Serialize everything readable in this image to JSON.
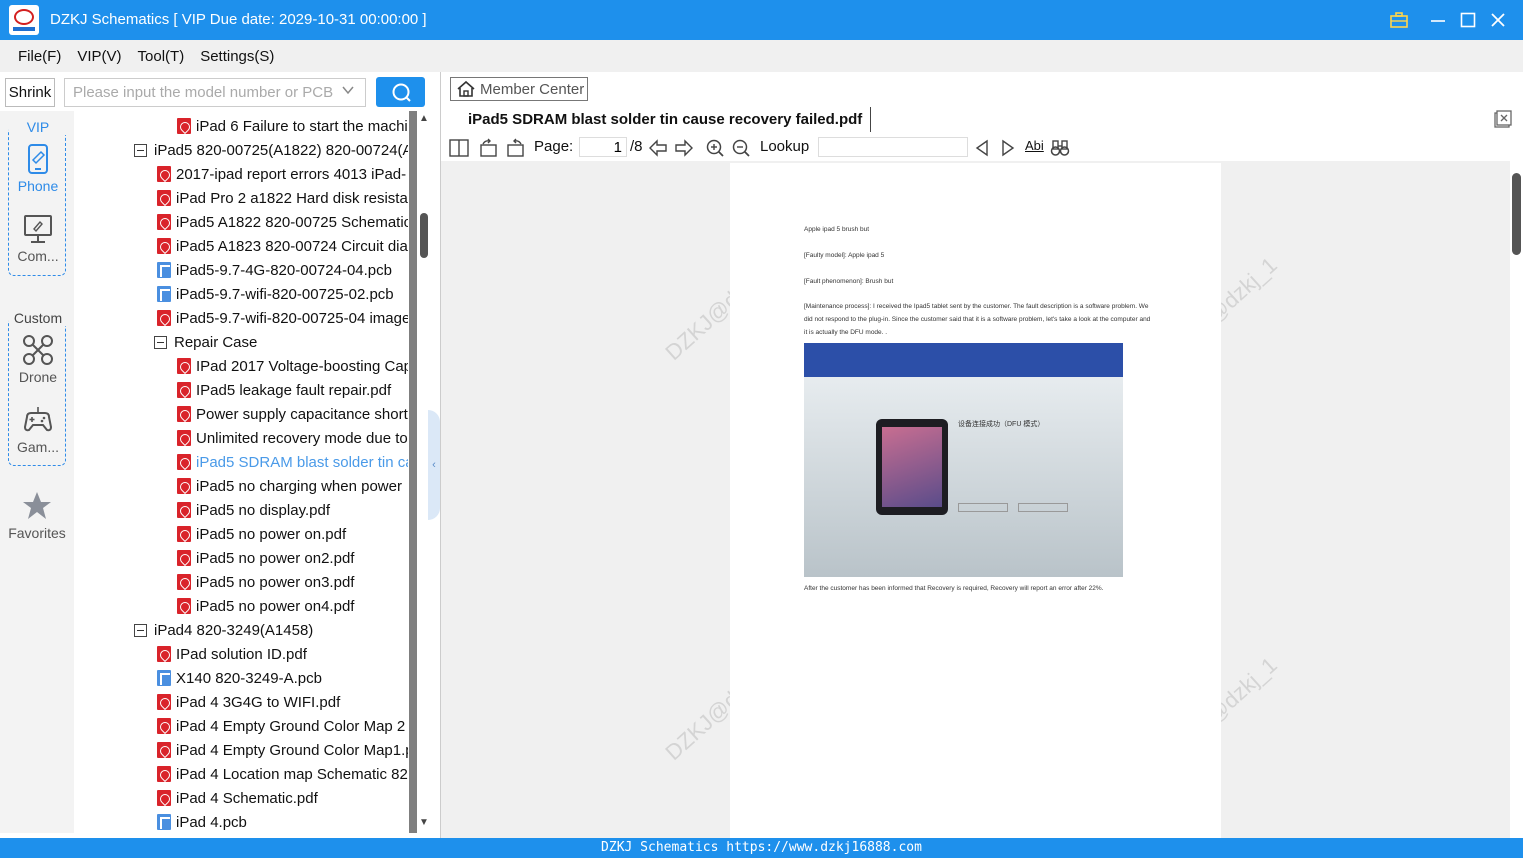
{
  "titlebar": {
    "title": "DZKJ Schematics [ VIP Due date: 2029-10-31 00:00:00 ]"
  },
  "menu": [
    "File(F)",
    "VIP(V)",
    "Tool(T)",
    "Settings(S)"
  ],
  "search": {
    "shrink_label": "Shrink",
    "placeholder": "Please input the model number or PCB"
  },
  "leftnav": {
    "vip_label": "VIP",
    "phone_label": "Phone",
    "computer_label": "Com...",
    "custom_label": "Custom",
    "drone_label": "Drone",
    "game_label": "Gam...",
    "favorites_label": "Favorites"
  },
  "tree": [
    {
      "type": "pdf",
      "label": "iPad 6 Failure to start the machi"
    },
    {
      "type": "folder",
      "label": "iPad5 820-00725(A1822) 820-00724(A"
    },
    {
      "type": "pdf",
      "label": "2017-ipad report errors 4013 iPad-"
    },
    {
      "type": "pdf",
      "label": "iPad Pro 2 a1822 Hard disk resistar"
    },
    {
      "type": "pdf",
      "label": "iPad5 A1822 820-00725 Schematic"
    },
    {
      "type": "pdf",
      "label": "iPad5 A1823 820-00724 Circuit dia"
    },
    {
      "type": "pcb",
      "label": "iPad5-9.7-4G-820-00724-04.pcb"
    },
    {
      "type": "pcb",
      "label": "iPad5-9.7-wifi-820-00725-02.pcb"
    },
    {
      "type": "pdf",
      "label": "iPad5-9.7-wifi-820-00725-04 image"
    },
    {
      "type": "folder",
      "label": "Repair Case"
    },
    {
      "type": "pdf",
      "label": "IPad 2017 Voltage-boosting Cap"
    },
    {
      "type": "pdf",
      "label": "IPad5 leakage fault repair.pdf"
    },
    {
      "type": "pdf",
      "label": "Power supply capacitance short"
    },
    {
      "type": "pdf",
      "label": "Unlimited recovery mode due to"
    },
    {
      "type": "pdf",
      "label": "iPad5 SDRAM blast solder tin ca",
      "selected": true
    },
    {
      "type": "pdf",
      "label": "iPad5 no charging when power"
    },
    {
      "type": "pdf",
      "label": "iPad5 no display.pdf"
    },
    {
      "type": "pdf",
      "label": "iPad5 no power on.pdf"
    },
    {
      "type": "pdf",
      "label": "iPad5 no power on2.pdf"
    },
    {
      "type": "pdf",
      "label": "iPad5 no power on3.pdf"
    },
    {
      "type": "pdf",
      "label": "iPad5 no power on4.pdf"
    },
    {
      "type": "folder",
      "label": "iPad4 820-3249(A1458)"
    },
    {
      "type": "pdf",
      "label": "IPad solution ID.pdf"
    },
    {
      "type": "pcb",
      "label": "X140 820-3249-A.pcb"
    },
    {
      "type": "pdf",
      "label": "iPad 4 3G4G to WIFI.pdf"
    },
    {
      "type": "pdf",
      "label": "iPad 4 Empty Ground Color Map 2"
    },
    {
      "type": "pdf",
      "label": "iPad 4 Empty Ground Color Map1.p"
    },
    {
      "type": "pdf",
      "label": "iPad 4 Location map Schematic 82"
    },
    {
      "type": "pdf",
      "label": "iPad 4 Schematic.pdf"
    },
    {
      "type": "pcb",
      "label": "iPad 4.pcb"
    }
  ],
  "member_center": "Member Center",
  "doc_tab": "iPad5 SDRAM blast solder tin cause recovery failed.pdf",
  "viewer_toolbar": {
    "page_label": "Page:",
    "page_value": "1",
    "page_total": "/8",
    "lookup_label": "Lookup",
    "abi_label": "Abi"
  },
  "pdf": {
    "lines": [
      "Apple ipad 5 brush but",
      "[Faulty model]: Apple ipad 5",
      "[Fault phenomenon]: Brush but",
      "[Maintenance process]: I received the Ipad5 tablet sent by the customer. The fault description is a software problem. We did not respond to the plug-in. Since the customer said that it is a software problem, let's take a look at the computer and it is actually the DFU mode. .",
      "After the customer has been informed that Recovery is required, Recovery will report an error after 22%."
    ],
    "photo_caption": "设备连接成功（DFU 模式）",
    "watermark": "DZKJ@dzkj_1"
  },
  "status": "DZKJ Schematics https://www.dzkj16888.com"
}
